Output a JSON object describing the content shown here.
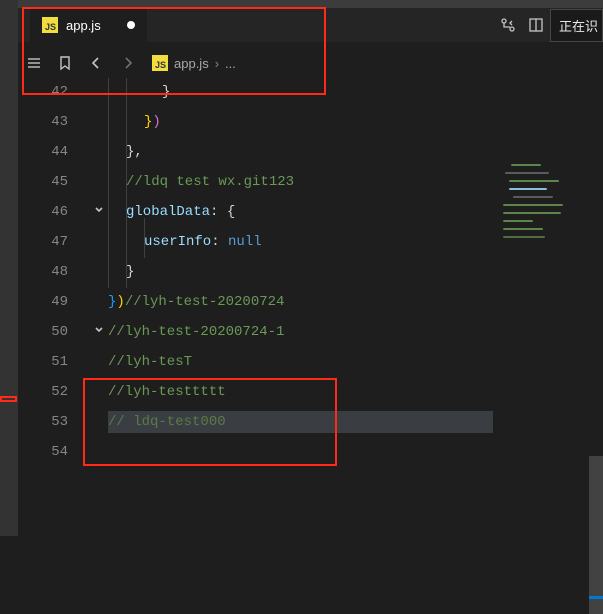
{
  "tab": {
    "filename": "app.js",
    "icon_label": "JS",
    "dirty": true
  },
  "topright": {
    "loading_label": "正在识"
  },
  "breadcrumb": {
    "filename": "app.js",
    "icon_label": "JS",
    "more": "..."
  },
  "gutter_start": 42,
  "code_lines": [
    {
      "n": 42,
      "indent": 3,
      "tokens": [
        {
          "t": "}",
          "c": "tk-brace"
        }
      ]
    },
    {
      "n": 43,
      "indent": 2,
      "tokens": [
        {
          "t": "}",
          "c": "tk-paren-y"
        },
        {
          "t": ")",
          "c": "tk-paren-p"
        }
      ]
    },
    {
      "n": 44,
      "indent": 1,
      "tokens": [
        {
          "t": "}",
          "c": "tk-brace"
        },
        {
          "t": ",",
          "c": "tk-brace"
        }
      ]
    },
    {
      "n": 45,
      "indent": 1,
      "tokens": [
        {
          "t": "//ldq test wx.git123",
          "c": "tk-comment"
        }
      ]
    },
    {
      "n": 46,
      "indent": 1,
      "fold": true,
      "tokens": [
        {
          "t": "globalData",
          "c": "tk-prop"
        },
        {
          "t": ": ",
          "c": "tk-brace"
        },
        {
          "t": "{",
          "c": "tk-brace"
        }
      ]
    },
    {
      "n": 47,
      "indent": 2,
      "tokens": [
        {
          "t": "userInfo",
          "c": "tk-prop"
        },
        {
          "t": ": ",
          "c": "tk-brace"
        },
        {
          "t": "null",
          "c": "tk-null"
        }
      ]
    },
    {
      "n": 48,
      "indent": 1,
      "tokens": [
        {
          "t": "}",
          "c": "tk-brace"
        }
      ]
    },
    {
      "n": 49,
      "indent": 0,
      "tokens": [
        {
          "t": "}",
          "c": "tk-paren-b"
        },
        {
          "t": ")",
          "c": "tk-paren-y"
        },
        {
          "t": "//lyh-test-20200724",
          "c": "tk-comment"
        }
      ]
    },
    {
      "n": 50,
      "indent": 0,
      "fold": true,
      "tokens": [
        {
          "t": "//lyh-test-20200724-1",
          "c": "tk-comment"
        }
      ]
    },
    {
      "n": 51,
      "indent": 0,
      "tokens": [
        {
          "t": "//lyh-tesT",
          "c": "tk-comment"
        }
      ]
    },
    {
      "n": 52,
      "indent": 0,
      "tokens": [
        {
          "t": "//lyh-testtttt",
          "c": "tk-comment"
        }
      ]
    },
    {
      "n": 53,
      "indent": 0,
      "highlight": true,
      "tokens": [
        {
          "t": "// ldq-test000",
          "c": "tk-comment-dim"
        }
      ]
    },
    {
      "n": 54,
      "indent": 0,
      "tokens": []
    }
  ],
  "line_height": 30
}
